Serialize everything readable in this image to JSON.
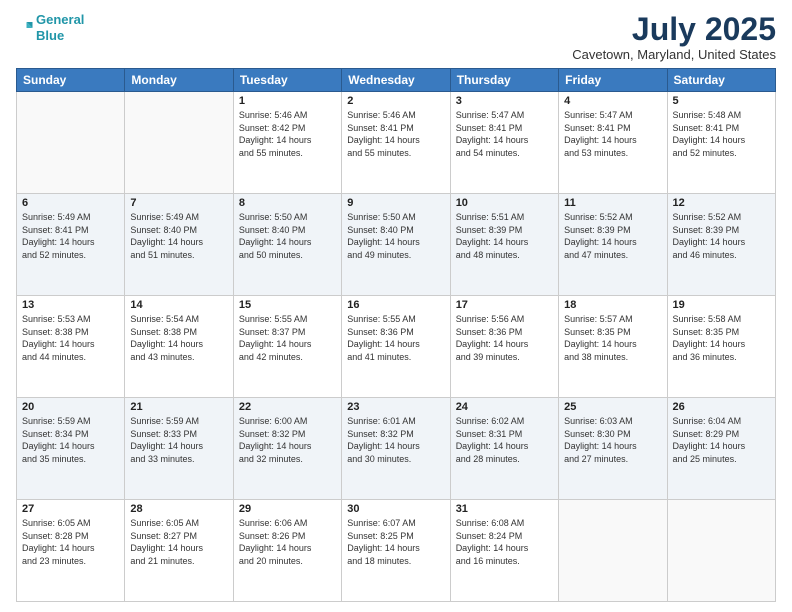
{
  "logo": {
    "line1": "General",
    "line2": "Blue"
  },
  "title": "July 2025",
  "subtitle": "Cavetown, Maryland, United States",
  "days_of_week": [
    "Sunday",
    "Monday",
    "Tuesday",
    "Wednesday",
    "Thursday",
    "Friday",
    "Saturday"
  ],
  "weeks": [
    [
      {
        "day": "",
        "info": ""
      },
      {
        "day": "",
        "info": ""
      },
      {
        "day": "1",
        "info": "Sunrise: 5:46 AM\nSunset: 8:42 PM\nDaylight: 14 hours\nand 55 minutes."
      },
      {
        "day": "2",
        "info": "Sunrise: 5:46 AM\nSunset: 8:41 PM\nDaylight: 14 hours\nand 55 minutes."
      },
      {
        "day": "3",
        "info": "Sunrise: 5:47 AM\nSunset: 8:41 PM\nDaylight: 14 hours\nand 54 minutes."
      },
      {
        "day": "4",
        "info": "Sunrise: 5:47 AM\nSunset: 8:41 PM\nDaylight: 14 hours\nand 53 minutes."
      },
      {
        "day": "5",
        "info": "Sunrise: 5:48 AM\nSunset: 8:41 PM\nDaylight: 14 hours\nand 52 minutes."
      }
    ],
    [
      {
        "day": "6",
        "info": "Sunrise: 5:49 AM\nSunset: 8:41 PM\nDaylight: 14 hours\nand 52 minutes."
      },
      {
        "day": "7",
        "info": "Sunrise: 5:49 AM\nSunset: 8:40 PM\nDaylight: 14 hours\nand 51 minutes."
      },
      {
        "day": "8",
        "info": "Sunrise: 5:50 AM\nSunset: 8:40 PM\nDaylight: 14 hours\nand 50 minutes."
      },
      {
        "day": "9",
        "info": "Sunrise: 5:50 AM\nSunset: 8:40 PM\nDaylight: 14 hours\nand 49 minutes."
      },
      {
        "day": "10",
        "info": "Sunrise: 5:51 AM\nSunset: 8:39 PM\nDaylight: 14 hours\nand 48 minutes."
      },
      {
        "day": "11",
        "info": "Sunrise: 5:52 AM\nSunset: 8:39 PM\nDaylight: 14 hours\nand 47 minutes."
      },
      {
        "day": "12",
        "info": "Sunrise: 5:52 AM\nSunset: 8:39 PM\nDaylight: 14 hours\nand 46 minutes."
      }
    ],
    [
      {
        "day": "13",
        "info": "Sunrise: 5:53 AM\nSunset: 8:38 PM\nDaylight: 14 hours\nand 44 minutes."
      },
      {
        "day": "14",
        "info": "Sunrise: 5:54 AM\nSunset: 8:38 PM\nDaylight: 14 hours\nand 43 minutes."
      },
      {
        "day": "15",
        "info": "Sunrise: 5:55 AM\nSunset: 8:37 PM\nDaylight: 14 hours\nand 42 minutes."
      },
      {
        "day": "16",
        "info": "Sunrise: 5:55 AM\nSunset: 8:36 PM\nDaylight: 14 hours\nand 41 minutes."
      },
      {
        "day": "17",
        "info": "Sunrise: 5:56 AM\nSunset: 8:36 PM\nDaylight: 14 hours\nand 39 minutes."
      },
      {
        "day": "18",
        "info": "Sunrise: 5:57 AM\nSunset: 8:35 PM\nDaylight: 14 hours\nand 38 minutes."
      },
      {
        "day": "19",
        "info": "Sunrise: 5:58 AM\nSunset: 8:35 PM\nDaylight: 14 hours\nand 36 minutes."
      }
    ],
    [
      {
        "day": "20",
        "info": "Sunrise: 5:59 AM\nSunset: 8:34 PM\nDaylight: 14 hours\nand 35 minutes."
      },
      {
        "day": "21",
        "info": "Sunrise: 5:59 AM\nSunset: 8:33 PM\nDaylight: 14 hours\nand 33 minutes."
      },
      {
        "day": "22",
        "info": "Sunrise: 6:00 AM\nSunset: 8:32 PM\nDaylight: 14 hours\nand 32 minutes."
      },
      {
        "day": "23",
        "info": "Sunrise: 6:01 AM\nSunset: 8:32 PM\nDaylight: 14 hours\nand 30 minutes."
      },
      {
        "day": "24",
        "info": "Sunrise: 6:02 AM\nSunset: 8:31 PM\nDaylight: 14 hours\nand 28 minutes."
      },
      {
        "day": "25",
        "info": "Sunrise: 6:03 AM\nSunset: 8:30 PM\nDaylight: 14 hours\nand 27 minutes."
      },
      {
        "day": "26",
        "info": "Sunrise: 6:04 AM\nSunset: 8:29 PM\nDaylight: 14 hours\nand 25 minutes."
      }
    ],
    [
      {
        "day": "27",
        "info": "Sunrise: 6:05 AM\nSunset: 8:28 PM\nDaylight: 14 hours\nand 23 minutes."
      },
      {
        "day": "28",
        "info": "Sunrise: 6:05 AM\nSunset: 8:27 PM\nDaylight: 14 hours\nand 21 minutes."
      },
      {
        "day": "29",
        "info": "Sunrise: 6:06 AM\nSunset: 8:26 PM\nDaylight: 14 hours\nand 20 minutes."
      },
      {
        "day": "30",
        "info": "Sunrise: 6:07 AM\nSunset: 8:25 PM\nDaylight: 14 hours\nand 18 minutes."
      },
      {
        "day": "31",
        "info": "Sunrise: 6:08 AM\nSunset: 8:24 PM\nDaylight: 14 hours\nand 16 minutes."
      },
      {
        "day": "",
        "info": ""
      },
      {
        "day": "",
        "info": ""
      }
    ]
  ]
}
